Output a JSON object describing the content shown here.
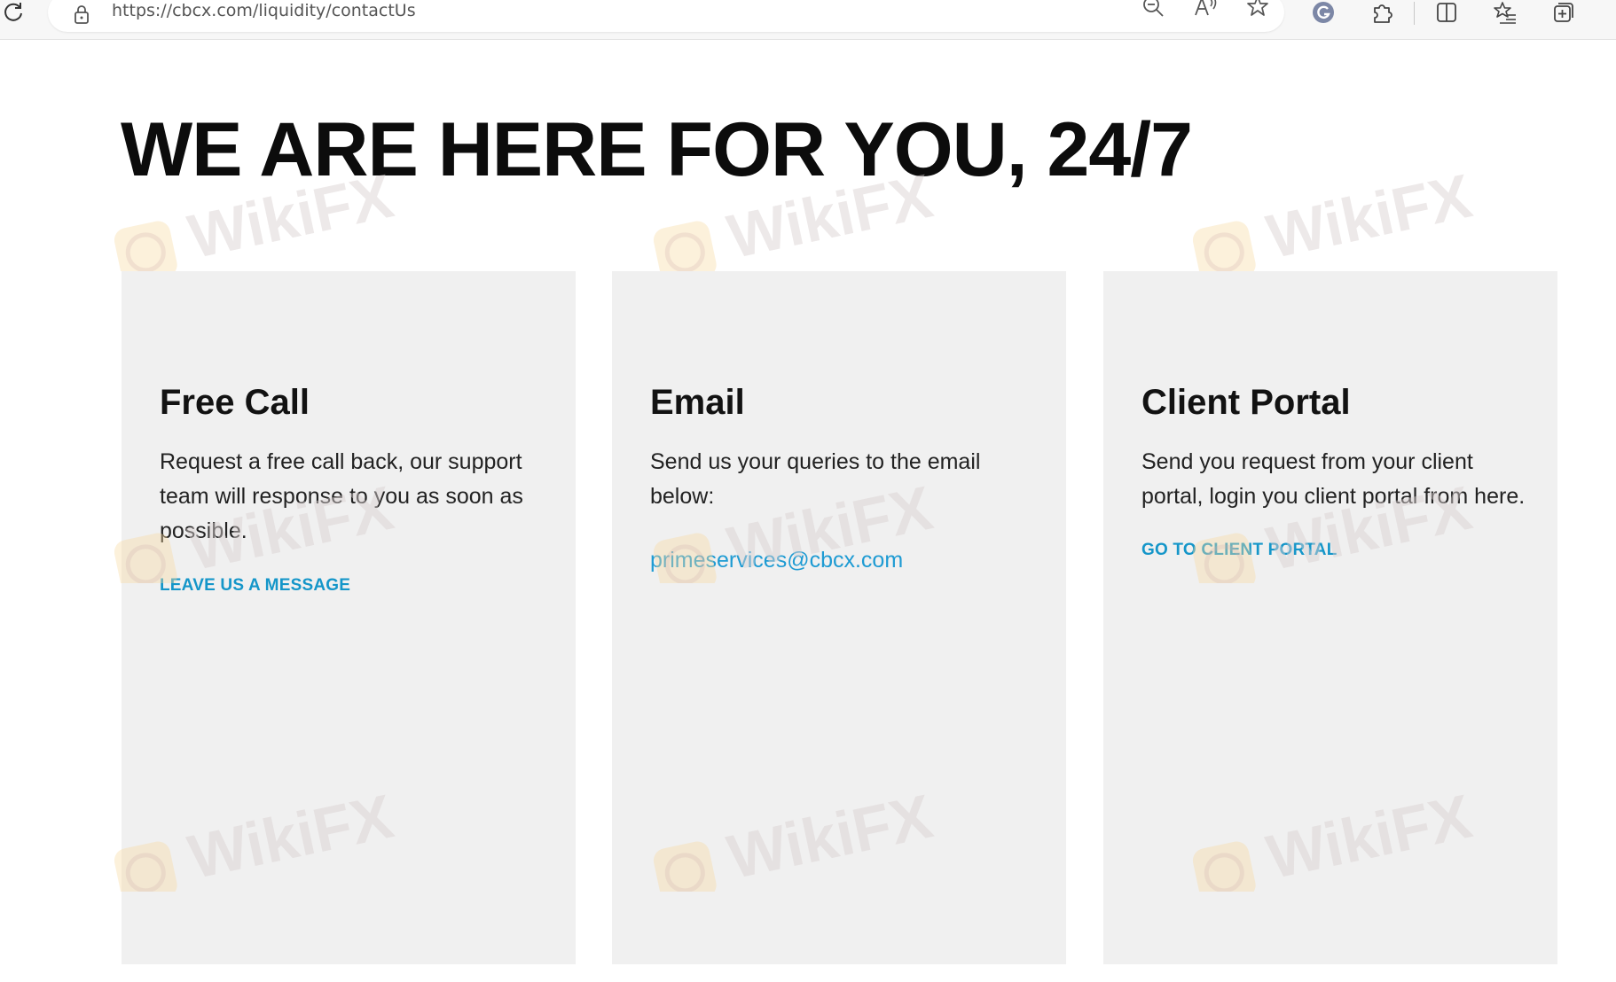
{
  "browser": {
    "url": "https://cbcx.com/liquidity/contactUs",
    "icons": {
      "reload": "reload-icon",
      "lock": "lock-icon",
      "zoom": "zoom-out-icon",
      "read_aloud": "read-aloud-icon",
      "favorite": "star-icon",
      "profile": "profile-icon",
      "extensions": "puzzle-icon",
      "split_screen": "split-screen-icon",
      "favorites_bar": "favorites-list-icon",
      "collections": "collections-icon"
    }
  },
  "page": {
    "title": "WE ARE HERE FOR YOU, 24/7",
    "cards": [
      {
        "title": "Free Call",
        "text": "Request a free call back, our support team will response to you as soon as possible.",
        "link": "LEAVE US A MESSAGE"
      },
      {
        "title": "Email",
        "text": "Send us your queries to the email below:",
        "email": "primeservices@cbcx.com"
      },
      {
        "title": "Client Portal",
        "text": "Send you request from your client portal, login you client portal from here.",
        "link": "GO TO CLIENT PORTAL"
      }
    ]
  },
  "watermark": {
    "text": "WikiFX"
  },
  "colors": {
    "link": "#1596c9",
    "card_background": "#f0f0f0",
    "heading": "#0c0c0c"
  }
}
